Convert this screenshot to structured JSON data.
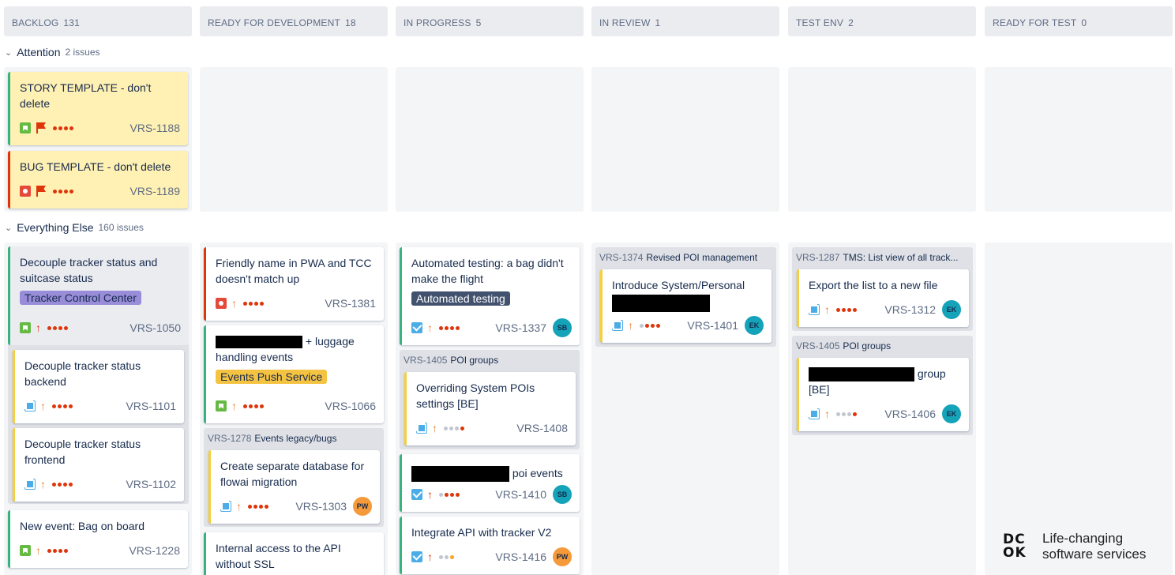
{
  "columns": [
    {
      "name": "BACKLOG",
      "count": "131"
    },
    {
      "name": "READY FOR DEVELOPMENT",
      "count": "18"
    },
    {
      "name": "IN PROGRESS",
      "count": "5"
    },
    {
      "name": "IN REVIEW",
      "count": "1"
    },
    {
      "name": "TEST ENV",
      "count": "2"
    },
    {
      "name": "READY FOR TEST",
      "count": "0"
    }
  ],
  "lanes": {
    "attention": {
      "name": "Attention",
      "count": "2 issues"
    },
    "everything_else": {
      "name": "Everything Else",
      "count": "160 issues"
    }
  },
  "cards": {
    "c1188": {
      "summary": "STORY TEMPLATE - don't delete",
      "key": "VRS-1188"
    },
    "c1189": {
      "summary": "BUG TEMPLATE - don't delete",
      "key": "VRS-1189"
    },
    "c1050": {
      "summary": "Decouple tracker status and suitcase status",
      "epic": "Tracker Control Center",
      "key": "VRS-1050"
    },
    "c1101": {
      "summary": "Decouple tracker status backend",
      "key": "VRS-1101"
    },
    "c1102": {
      "summary": "Decouple tracker status frontend",
      "key": "VRS-1102"
    },
    "c1228": {
      "summary": "New event: Bag on board",
      "key": "VRS-1228"
    },
    "c1381": {
      "summary": "Friendly name in PWA and TCC doesn't match up",
      "key": "VRS-1381"
    },
    "c1066": {
      "summary_tail": "+ luggage handling events",
      "epic": "Events Push Service",
      "key": "VRS-1066"
    },
    "c1303": {
      "summary": "Create separate database for flowai migration",
      "key": "VRS-1303",
      "avatar": "PW"
    },
    "c_ssl": {
      "summary": "Internal access to the API without SSL"
    },
    "c1337": {
      "summary": "Automated testing: a bag didn't make the flight",
      "epic": "Automated testing",
      "key": "VRS-1337",
      "avatar": "SB"
    },
    "c1408": {
      "summary": "Overriding System POIs settings [BE]",
      "key": "VRS-1408"
    },
    "c1410": {
      "summary_tail": "poi events",
      "key": "VRS-1410",
      "avatar": "SB"
    },
    "c1416": {
      "summary": "Integrate API with tracker V2",
      "key": "VRS-1416",
      "avatar": "PW"
    },
    "c1401": {
      "summary": "Introduce System/Personal",
      "key": "VRS-1401",
      "avatar": "EK"
    },
    "c1312": {
      "summary": "Export the list to a new file",
      "key": "VRS-1312",
      "avatar": "EK"
    },
    "c1406": {
      "summary_tail": "group",
      "summary_line2": "[BE]",
      "key": "VRS-1406",
      "avatar": "EK"
    }
  },
  "parents": {
    "p1278": {
      "key": "VRS-1278",
      "name": "Events legacy/bugs"
    },
    "p1405a": {
      "key": "VRS-1405",
      "name": "POI groups"
    },
    "p1374": {
      "key": "VRS-1374",
      "name": "Revised POI management"
    },
    "p1287": {
      "key": "VRS-1287",
      "name": "TMS: List view of all track..."
    },
    "p1405b": {
      "key": "VRS-1405",
      "name": "POI groups"
    }
  },
  "brand": {
    "logo_line1": "DC",
    "logo_line2": "OK",
    "tagline_1": "Life-changing",
    "tagline_2": "software services"
  },
  "colors": {
    "story_border": "#36b37e",
    "bug_border": "#de350b",
    "subtask_border": "#f4d03f",
    "epic_purple": "#998dd9",
    "epic_orange": "#f5c342",
    "epic_dark": "#42526e",
    "avatar_teal": "#14a3b8",
    "avatar_orange": "#f59a3a"
  }
}
